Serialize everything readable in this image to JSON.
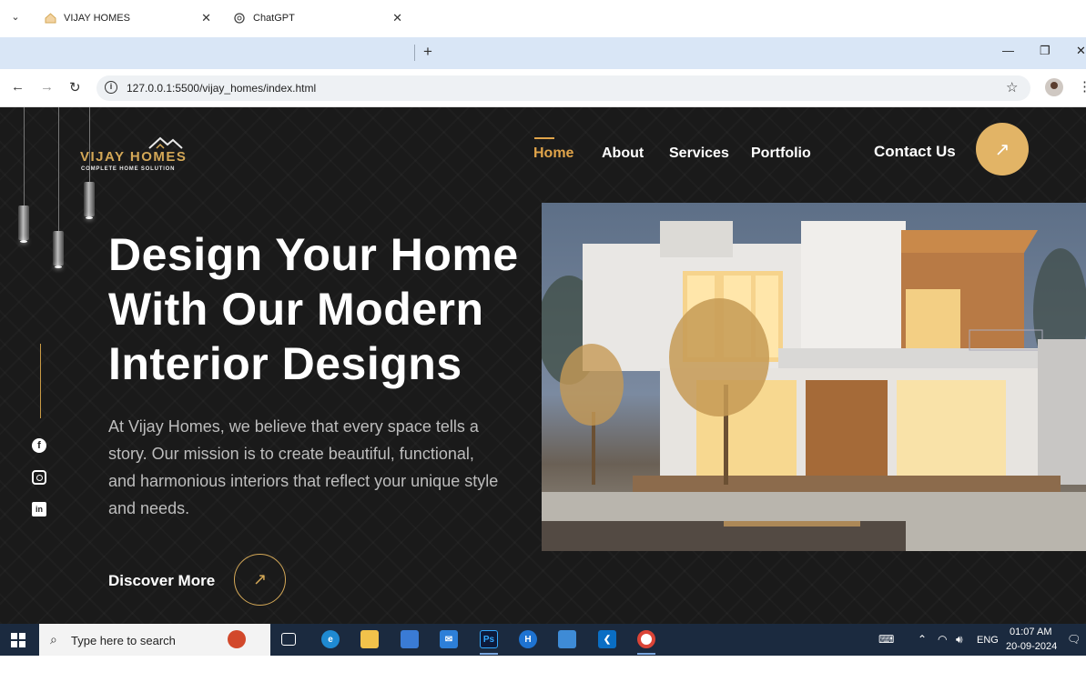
{
  "browser": {
    "tabs": [
      {
        "title": "VIJAY HOMES",
        "active": true
      },
      {
        "title": "ChatGPT",
        "active": false
      }
    ],
    "url": "127.0.0.1:5500/vijay_homes/index.html"
  },
  "site": {
    "logo": {
      "brand": "VIJAY HOMES",
      "tagline": "COMPLETE HOME SOLUTION"
    },
    "nav": {
      "home": "Home",
      "about": "About",
      "services": "Services",
      "portfolio": "Portfolio"
    },
    "contact_label": "Contact Us",
    "hero": {
      "title_line1": "Design Your Home",
      "title_line2": "With Our Modern",
      "title_line3": "Interior Designs",
      "text": "At Vijay Homes, we believe that every space tells a story. Our mission is to create beautiful, functional, and harmonious interiors that reflect your unique style and needs."
    },
    "discover_label": "Discover More",
    "colors": {
      "accent": "#e0a44a",
      "background": "#1a1a1a"
    }
  },
  "taskbar": {
    "search_placeholder": "Type here to search",
    "language": "ENG",
    "time": "01:07 AM",
    "date": "20-09-2024"
  }
}
